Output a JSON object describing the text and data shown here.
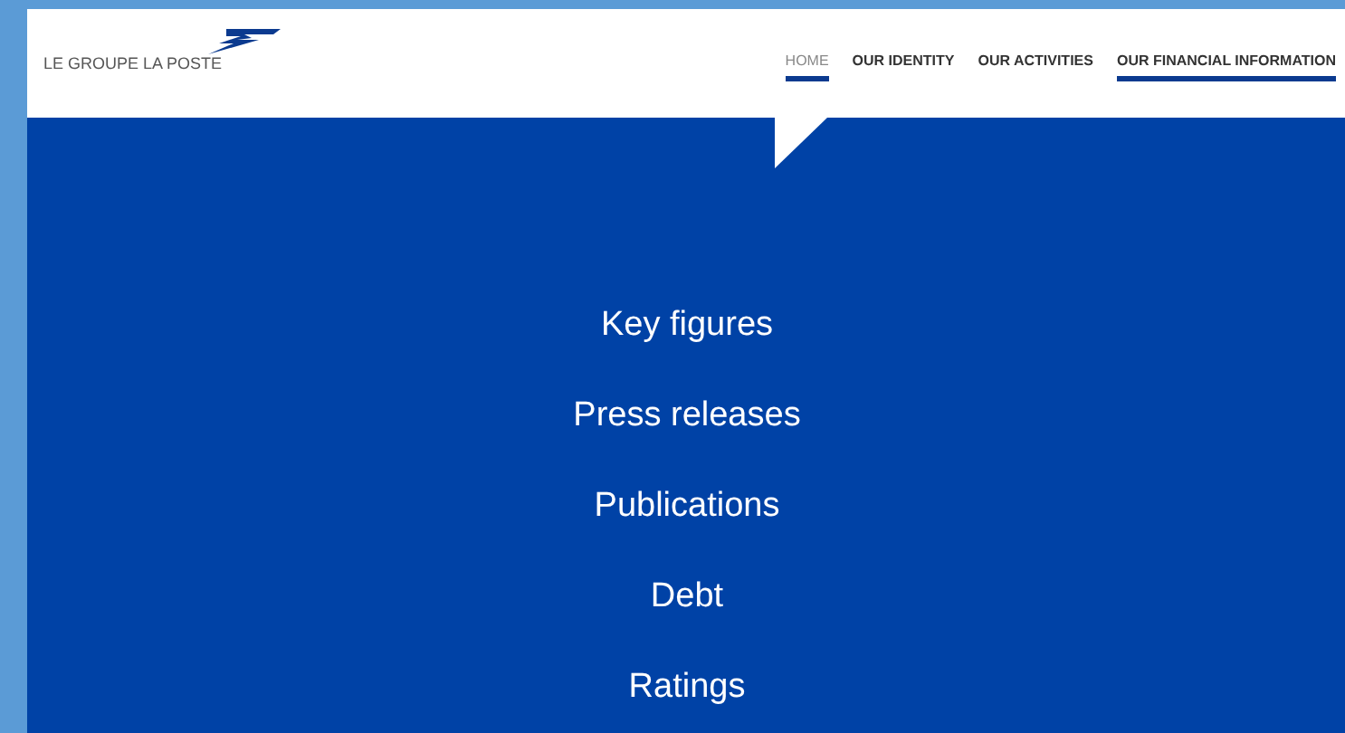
{
  "logo": {
    "text": "LE GROUPE LA POSTE"
  },
  "nav": [
    {
      "label": "HOME",
      "selected": true,
      "underlined": true
    },
    {
      "label": "OUR IDENTITY",
      "selected": false,
      "underlined": false
    },
    {
      "label": "OUR ACTIVITIES",
      "selected": false,
      "underlined": false
    },
    {
      "label": "OUR FINANCIAL INFORMATION",
      "selected": false,
      "underlined": true
    }
  ],
  "menu": [
    "Key figures",
    "Press releases",
    "Publications",
    "Debt",
    "Ratings"
  ]
}
